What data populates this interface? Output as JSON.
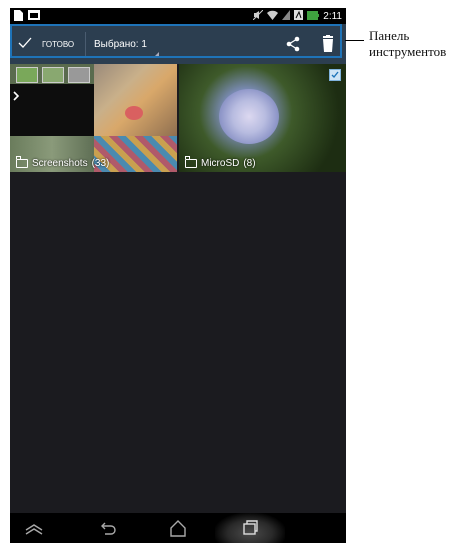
{
  "status_bar": {
    "time": "2:11"
  },
  "action_bar": {
    "done_label": "ГОТОВО",
    "selected_label": "Выбрано: 1"
  },
  "callout": {
    "line1": "Панель",
    "line2": "инструментов"
  },
  "albums": [
    {
      "name": "Screenshots",
      "count": "(33)"
    },
    {
      "name": "MicroSD",
      "count": "(8)"
    }
  ],
  "colors": {
    "action_bar": "#2c3e50",
    "highlight": "#1e73b8",
    "background": "#1b1b1f"
  }
}
